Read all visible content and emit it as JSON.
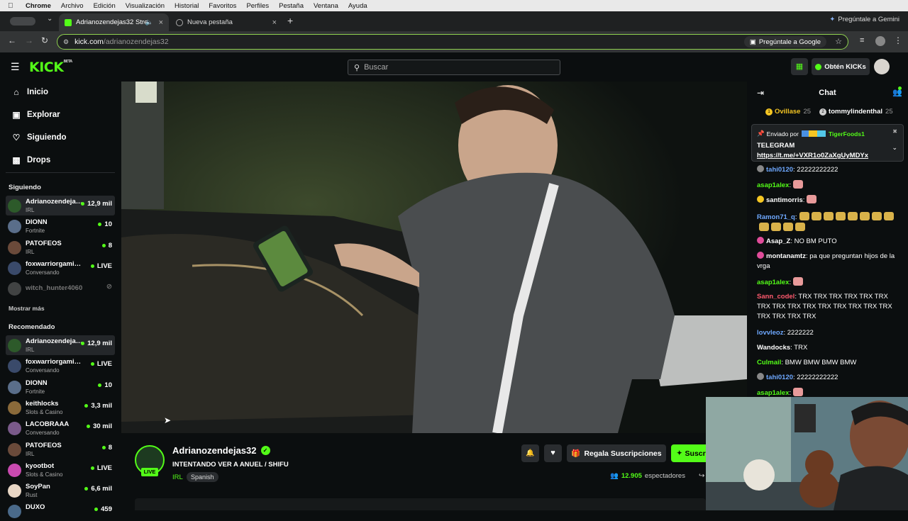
{
  "menubar": {
    "app": "Chrome",
    "items": [
      "Archivo",
      "Edición",
      "Visualización",
      "Historial",
      "Favoritos",
      "Perfiles",
      "Pestaña",
      "Ventana",
      "Ayuda"
    ]
  },
  "tabs": [
    {
      "title": "Adrianozendejas32 Strea",
      "active": true
    },
    {
      "title": "Nueva pestaña",
      "active": false
    }
  ],
  "gemini_top": "Pregúntale a Gemini",
  "address": {
    "host": "kick.com",
    "path": "/adrianozendejas32",
    "ask_google": "Pregúntale a Google"
  },
  "kick": {
    "logo": "KICK",
    "logo_sup": "BETA",
    "search_placeholder": "Buscar",
    "get_kicks": "Obtén KICKs"
  },
  "nav": [
    {
      "label": "Inicio",
      "icon": "home-icon"
    },
    {
      "label": "Explorar",
      "icon": "explore-icon"
    },
    {
      "label": "Siguiendo",
      "icon": "heart-icon"
    },
    {
      "label": "Drops",
      "icon": "drops-icon"
    }
  ],
  "following_title": "Siguiendo",
  "following": [
    {
      "name": "Adrianozendejas32",
      "category": "IRL",
      "viewers": "12,9 mil",
      "selected": true,
      "color": "#2d5a2a"
    },
    {
      "name": "DIONN",
      "category": "Fortnite",
      "viewers": "10",
      "color": "#5a6e8a"
    },
    {
      "name": "PATOFEOS",
      "category": "IRL",
      "viewers": "8",
      "color": "#6a4a3a"
    },
    {
      "name": "foxwarriorgaming4",
      "category": "Conversando",
      "viewers": "LIVE",
      "color": "#3a4a6a"
    },
    {
      "name": "witch_hunter4060",
      "category": "",
      "viewers": "",
      "offline": true,
      "color": "#777"
    }
  ],
  "show_more": "Mostrar más",
  "recommended_title": "Recomendado",
  "recommended": [
    {
      "name": "Adrianozendejas32",
      "category": "IRL",
      "viewers": "12,9 mil",
      "selected": true,
      "color": "#2d5a2a"
    },
    {
      "name": "foxwarriorgaming4",
      "category": "Conversando",
      "viewers": "LIVE",
      "color": "#3a4a6a"
    },
    {
      "name": "DIONN",
      "category": "Fortnite",
      "viewers": "10",
      "color": "#5a6e8a"
    },
    {
      "name": "keithlocks",
      "category": "Slots & Casino",
      "viewers": "3,3 mil",
      "color": "#8a6a3a"
    },
    {
      "name": "LACOBRAAA",
      "category": "Conversando",
      "viewers": "30 mil",
      "color": "#7a5a8a"
    },
    {
      "name": "PATOFEOS",
      "category": "IRL",
      "viewers": "8",
      "color": "#6a4a3a"
    },
    {
      "name": "kyootbot",
      "category": "Slots & Casino",
      "viewers": "LIVE",
      "color": "#c94ab0"
    },
    {
      "name": "SoyPan",
      "category": "Rust",
      "viewers": "6,6 mil",
      "color": "#e8d7c5"
    },
    {
      "name": "DUXO",
      "category": "",
      "viewers": "459",
      "color": "#4a6a8a"
    }
  ],
  "stream": {
    "streamer": "Adrianozendejas32",
    "title": "INTENTANDO VER A ANUEL / SHIFU",
    "category": "IRL",
    "language": "Spanish",
    "live": "LIVE",
    "gift_subs": "Regala Suscripciones",
    "subscribe": "Suscr",
    "viewers": "12.905",
    "viewers_label": "espectadores"
  },
  "chat": {
    "title": "Chat",
    "top_gifters": [
      {
        "rank": "1",
        "name": "Ovillase",
        "count": "25"
      },
      {
        "rank": "2",
        "name": "tommylindenthal",
        "count": "25"
      }
    ],
    "pinned": {
      "sent_by": "Enviado por",
      "user": "TigerFoods1",
      "line1": "TELEGRAM",
      "link": "https://t.me/+VXR1o0ZaXgUyMDYx"
    },
    "messages": [
      {
        "user": "tahi0120",
        "color": "#6ea8ff",
        "text": ": 22222222222",
        "badge": "grey"
      },
      {
        "user": "asap1alex",
        "color": "#53fc18",
        "text": ":",
        "emote": 1
      },
      {
        "user": "santimorris",
        "color": "#fff",
        "text": ":",
        "badge": "yellow",
        "emote": 1
      },
      {
        "user": "Ramon71_q",
        "color": "#6ea8ff",
        "text": ":",
        "emotes_wrap": true
      },
      {
        "user": "Asap_Z",
        "color": "#fff",
        "text": ": NO BM PUTO",
        "badge": "pink"
      },
      {
        "user": "montanamtz",
        "color": "#fff",
        "text": ": pa que preguntan hijos de la vrga",
        "badge": "pink"
      },
      {
        "user": "asap1alex",
        "color": "#53fc18",
        "text": ":",
        "emote": 1
      },
      {
        "user": "Sann_codel",
        "color": "#ff5a6e",
        "text": ": TRX TRX TRX TRX TRX TRX TRX TRX TRX TRX TRX TRX TRX TRX TRX TRX TRX TRX TRX"
      },
      {
        "user": "lovvleoz",
        "color": "#6ea8ff",
        "text": ": 2222222"
      },
      {
        "user": "Wandocks",
        "color": "#fff",
        "text": ": TRX"
      },
      {
        "user": "Culmail",
        "color": "#53fc18",
        "text": ": BMW BMW BMW BMW"
      },
      {
        "user": "tahi0120",
        "color": "#6ea8ff",
        "text": ": 22222222222",
        "badge": "grey"
      },
      {
        "user": "asap1alex",
        "color": "#53fc18",
        "text": ":",
        "emote": 1
      }
    ]
  }
}
